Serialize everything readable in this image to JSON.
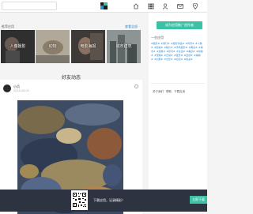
{
  "topbar": {
    "search_placeholder": "",
    "nav_icons": [
      "home-icon",
      "grid-icon",
      "user-icon",
      "mail-icon",
      "location-icon"
    ]
  },
  "explore": {
    "title": "推荐应用",
    "more_link": "查看全部",
    "categories": [
      {
        "label": "人像摄影",
        "bg": "#3a3a3a"
      },
      {
        "label": "动物",
        "bg": "#9a8f80"
      },
      {
        "label": "电影海报",
        "bg": "#504a45"
      },
      {
        "label": "城市建筑",
        "bg": "#6d7474"
      }
    ]
  },
  "feed": {
    "title": "好友动态",
    "post": {
      "user": "小贞",
      "time": "2015-08-01"
    }
  },
  "sidebar": {
    "cta": "成为应用推广创作者",
    "hot_title": "一些应用",
    "tags": [
      "#摄影#",
      "#旅行#",
      "#摄影作品#",
      "#风景#",
      "#人像#",
      "#街拍#",
      "#胶片#",
      "#手机摄影#",
      "#黑白#",
      "#城市#",
      "#建筑#",
      "#花卉#",
      "#生活#",
      "#美食#",
      "#动物#",
      "#宠物#",
      "#日常#",
      "#夜景#",
      "#自然#",
      "#静物#",
      "#创意#",
      "#光影#",
      "#纪实#",
      "#色彩#"
    ],
    "links": [
      "关于我们",
      "帮助",
      "下载应用"
    ]
  },
  "footer": {
    "text": "下载应用，记录精彩！",
    "button": "立即下载"
  },
  "colors": {
    "accent": "#3bc2a4",
    "link": "#2e8bd0",
    "footer_bg": "#2d3340"
  }
}
